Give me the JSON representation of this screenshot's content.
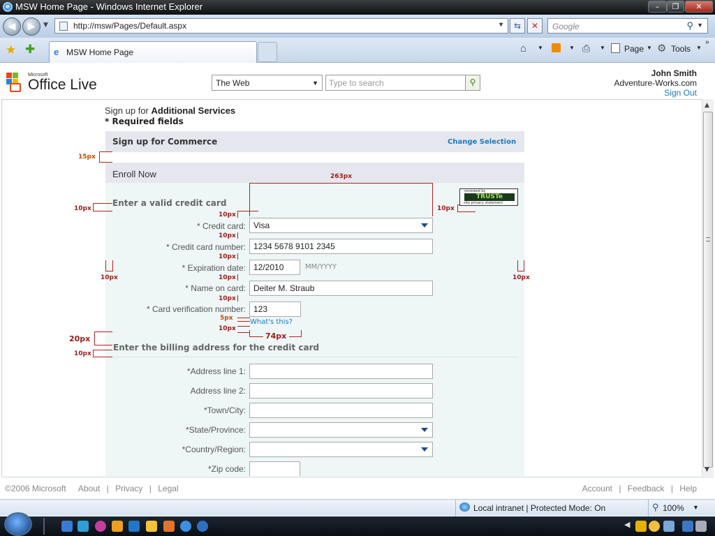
{
  "window": {
    "title": "MSW Home Page - Windows Internet Explorer"
  },
  "browser": {
    "url": "http://msw/Pages/Default.aspx",
    "search_placeholder": "Google",
    "tab_label": "MSW Home Page",
    "tools": {
      "page": "Page",
      "tools": "Tools"
    }
  },
  "header": {
    "logo_small": "Microsoft",
    "logo": "Office Live",
    "search_scope": "The Web",
    "search_placeholder": "Type to search",
    "user_name": "John Smith",
    "user_domain": "Adventure-Works.com",
    "sign_out": "Sign Out"
  },
  "page": {
    "heading_prefix": "Sign up for",
    "heading_strong": "Additional Services",
    "required_note": "* Required fields",
    "commerce_title": "Sign up for Commerce",
    "change_selection": "Change Selection",
    "enroll_title": "Enroll Now",
    "credit_section": "Enter a valid credit card",
    "billing_section": "Enter the billing address for the credit card",
    "trust_badge": {
      "top": "reviewed by",
      "main": "TRUSTe",
      "bottom": "site privacy statement"
    }
  },
  "credit_form": {
    "card_label": "* Credit card:",
    "card_value": "Visa",
    "number_label": "* Credit card number:",
    "number_value": "1234 5678 9101 2345",
    "exp_label": "* Expiration date:",
    "exp_value": "12/2010",
    "exp_hint": "MM/YYYY",
    "name_label": "* Name on card:",
    "name_value": "Deiter M. Straub",
    "cvn_label": "* Card verification number:",
    "cvn_value": "123",
    "whats_this": "What's this?"
  },
  "billing_form": {
    "addr1": "*Address line 1:",
    "addr2": "Address line 2:",
    "town": "*Town/City:",
    "state": "*State/Province:",
    "country": "*Country/Region:",
    "zip": "*Zip code:"
  },
  "annotations": {
    "a15": "15px",
    "a263": "263px",
    "a10": "10px",
    "a20": "20px",
    "a5": "5px",
    "a74": "74px"
  },
  "footer": {
    "copyright": "©2006 Microsoft",
    "left_links": [
      "About",
      "Privacy",
      "Legal"
    ],
    "right_links": [
      "Account",
      "Feedback",
      "Help"
    ]
  },
  "status": {
    "zone": "Local intranet | Protected Mode: On",
    "zoom": "100%"
  }
}
